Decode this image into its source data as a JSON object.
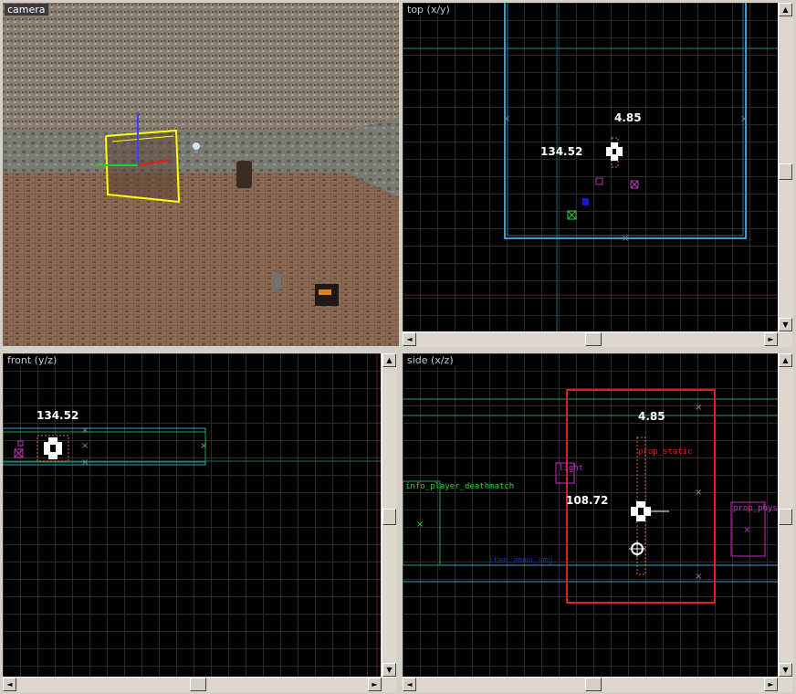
{
  "views": {
    "camera": {
      "label": "camera"
    },
    "top": {
      "label": "top (x/y)",
      "measure_x": "4.85",
      "measure_y": "134.52"
    },
    "front": {
      "label": "front (y/z)",
      "measure_y": "134.52"
    },
    "side": {
      "label": "side (x/z)",
      "measure_x": "4.85",
      "measure_z": "108.72",
      "entities": {
        "prop_static": "prop_static",
        "light": "light",
        "info_player_deathmatch": "info_player_deathmatch",
        "prop_physics": "prop_phys",
        "blue_entity": "item_ammo_smg"
      }
    }
  },
  "colors": {
    "grid": "#2a2a2a",
    "cyan_brush": "#3aa0c8",
    "green_brush": "#28a050",
    "selected": "#e02020",
    "entity_magenta": "#c030c0",
    "entity_green": "#30d030"
  },
  "scrollbars": {
    "arrow_up": "▲",
    "arrow_down": "▼",
    "arrow_left": "◄",
    "arrow_right": "►"
  }
}
